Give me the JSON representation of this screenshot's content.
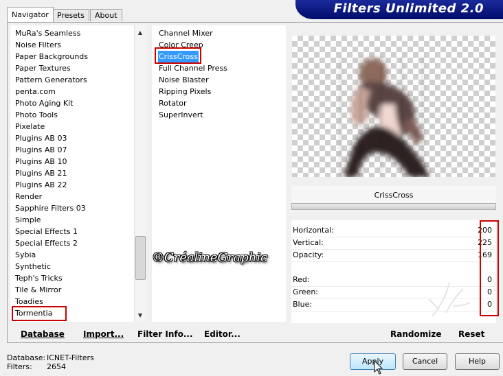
{
  "tabs": [
    "Navigator",
    "Presets",
    "About"
  ],
  "banner_title": "Filters Unlimited 2.0",
  "categories": [
    "MuRa's Seamless",
    "Noise Filters",
    "Paper Backgrounds",
    "Paper Textures",
    "Pattern Generators",
    "penta.com",
    "Photo Aging Kit",
    "Photo Tools",
    "Pixelate",
    "Plugins AB 03",
    "Plugins AB 07",
    "Plugins AB 10",
    "Plugins AB 21",
    "Plugins AB 22",
    "Render",
    "Sapphire Filters 03",
    "Simple",
    "Special Effects 1",
    "Special Effects 2",
    "Sybia",
    "Synthetic",
    "Teph's Tricks",
    "Tile & Mirror",
    "Toadies",
    "Tormentia"
  ],
  "selected_category": "Tormentia",
  "filters": [
    "Channel Mixer",
    "Color Creep",
    "CrissCross",
    "Full Channel Press",
    "Noise Blaster",
    "Ripping Pixels",
    "Rotator",
    "SuperInvert"
  ],
  "selected_filter": "CrissCross",
  "watermark": "©CréalineGraphic",
  "filter_name": "CrissCross",
  "params": [
    {
      "label": "Horizontal:",
      "value": "200"
    },
    {
      "label": "Vertical:",
      "value": "225"
    },
    {
      "label": "Opacity:",
      "value": "169"
    },
    {
      "label": "Red:",
      "value": "0"
    },
    {
      "label": "Green:",
      "value": "0"
    },
    {
      "label": "Blue:",
      "value": "0"
    }
  ],
  "buttons": {
    "database": "Database",
    "import": "Import...",
    "filter_info": "Filter Info...",
    "editor": "Editor...",
    "randomize": "Randomize",
    "reset": "Reset",
    "apply": "Apply",
    "cancel": "Cancel",
    "help": "Help"
  },
  "footer": {
    "database_label": "Database:",
    "database_value": "ICNET-Filters",
    "filters_label": "Filters:",
    "filters_value": "2654"
  },
  "colors": {
    "highlight_box": "#cc0000",
    "selection": "#3399ff",
    "banner": "#0a1a8a"
  }
}
